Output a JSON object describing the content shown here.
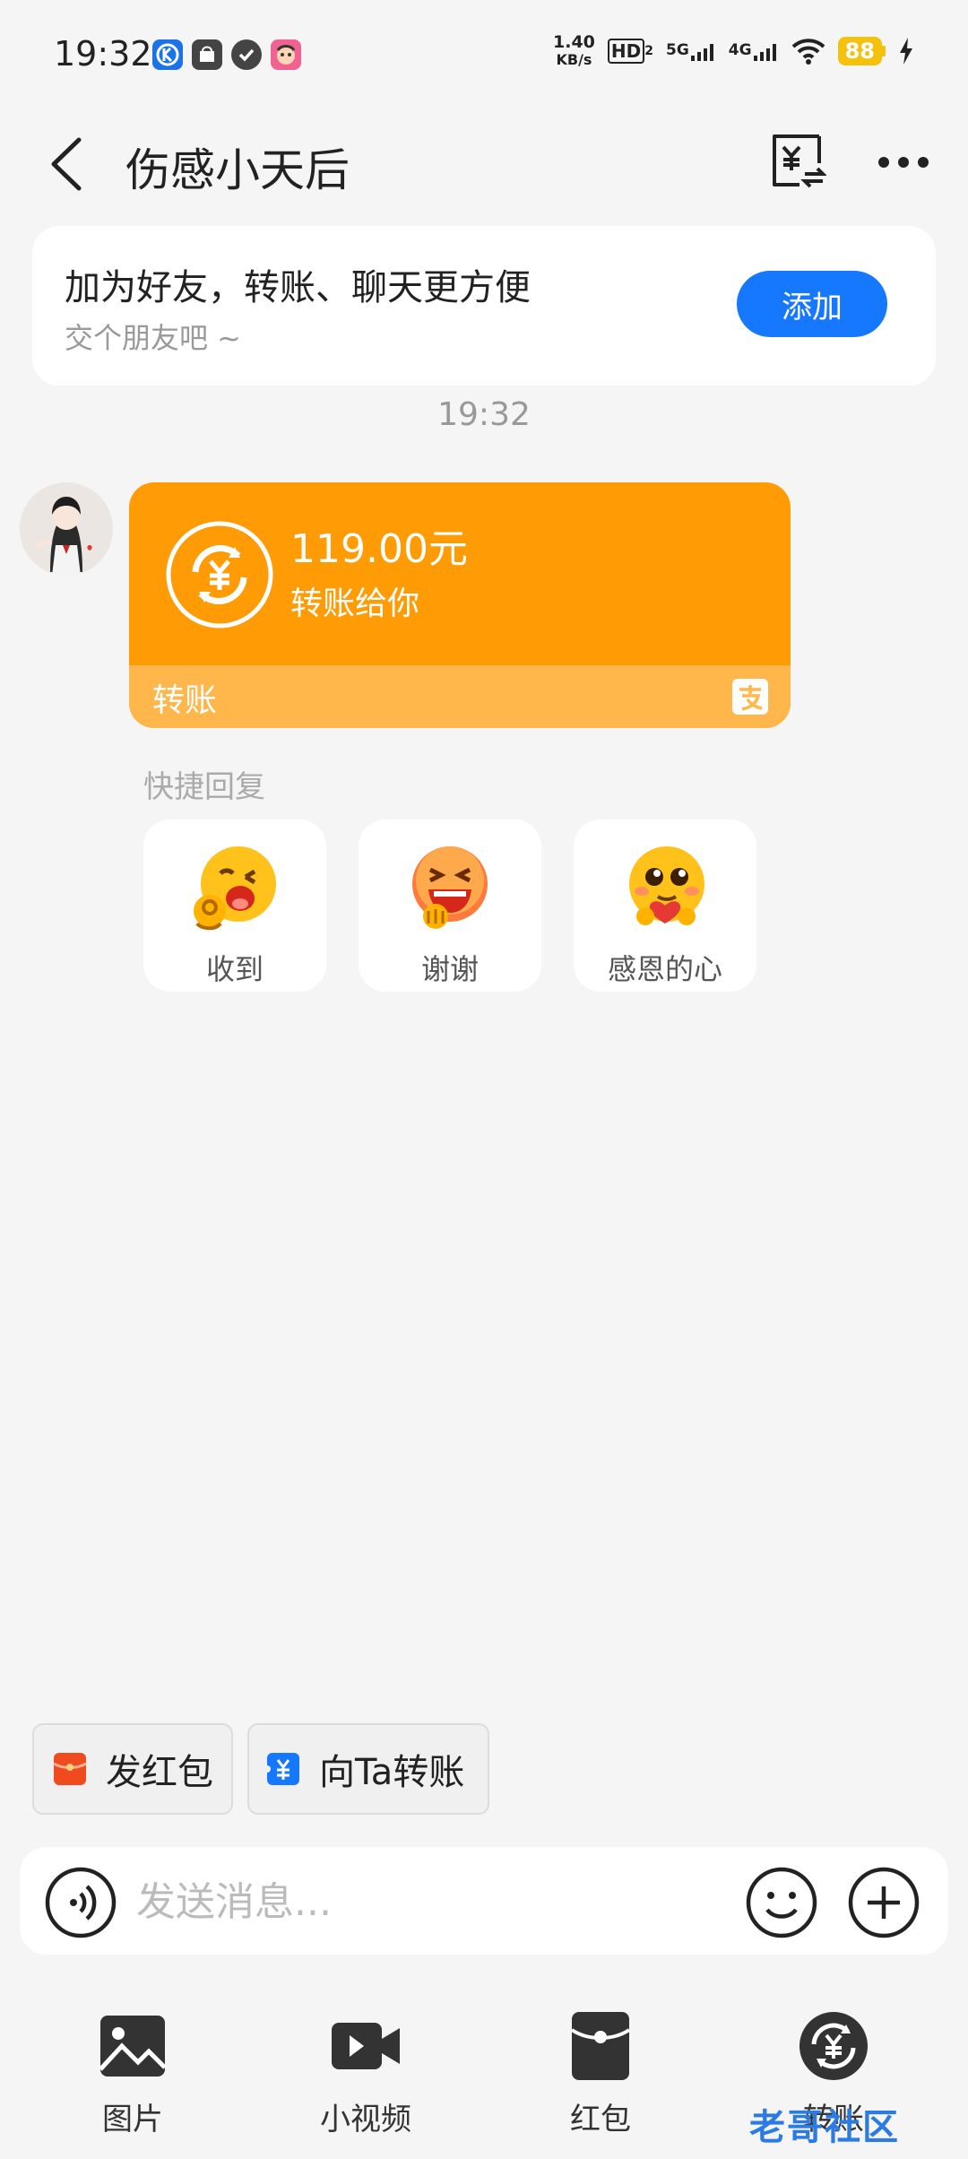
{
  "status_bar": {
    "time": "19:32",
    "net_speed_top": "1.40",
    "net_speed_unit": "KB/s",
    "hd_label": "HD",
    "net_5g": "5G",
    "net_4g": "4G",
    "battery": "88"
  },
  "header": {
    "title": "伤感小天后"
  },
  "banner": {
    "title": "加为好友，转账、聊天更方便",
    "subtitle": "交个朋友吧 ~",
    "add_label": "添加"
  },
  "chat": {
    "timestamp": "19:32",
    "transfer_card": {
      "amount": "119.00元",
      "subtitle": "转账给你",
      "footer_label": "转账"
    }
  },
  "quick_reply": {
    "title": "快捷回复",
    "items": [
      {
        "label": "收到",
        "icon": "ok-emoji-icon"
      },
      {
        "label": "谢谢",
        "icon": "thanks-emoji-icon"
      },
      {
        "label": "感恩的心",
        "icon": "grateful-emoji-icon"
      }
    ]
  },
  "quick_buttons": {
    "red_packet": "发红包",
    "transfer_to": "向Ta转账"
  },
  "input": {
    "placeholder": "发送消息..."
  },
  "toolbar": {
    "items": [
      {
        "label": "图片",
        "icon": "image-icon"
      },
      {
        "label": "小视频",
        "icon": "video-icon"
      },
      {
        "label": "红包",
        "icon": "red-packet-icon"
      },
      {
        "label": "转账",
        "icon": "transfer-icon"
      }
    ]
  },
  "watermark": "老哥社区",
  "colors": {
    "accent_blue": "#1677ff",
    "transfer_orange": "#ff9b04",
    "transfer_orange_light": "#ffb64b",
    "red_packet": "#f04b1f"
  }
}
